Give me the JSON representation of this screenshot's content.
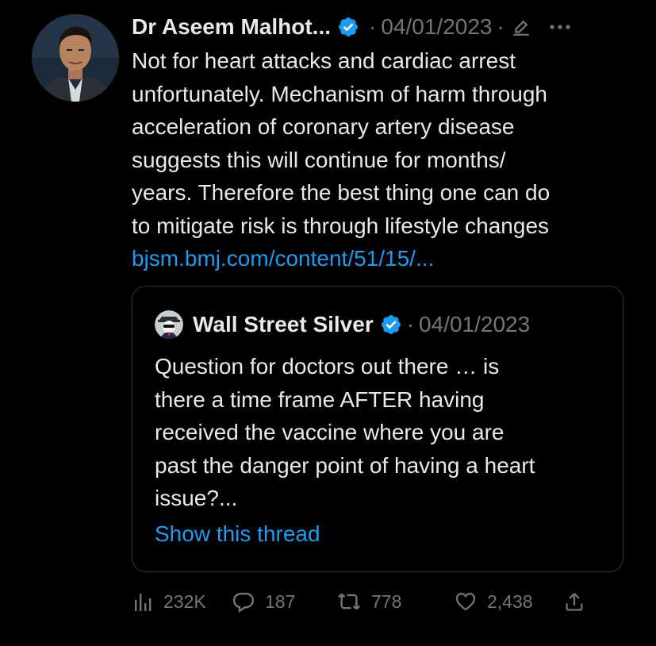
{
  "tweet": {
    "author_name": "Dr Aseem Malhot...",
    "date": "04/01/2023",
    "separator": "·",
    "more": "···",
    "text": "Not for heart attacks and cardiac arrest\nunfortunately. Mechanism of harm through\nacceleration of coronary artery disease\nsuggests this will continue for months/\nyears. Therefore the best thing one can do\nto mitigate risk is through lifestyle changes",
    "link": "bjsm.bmj.com/content/51/15/..."
  },
  "quote": {
    "author_name": "Wall Street Silver",
    "date": "04/01/2023",
    "separator": "·",
    "text": "Question for doctors out there … is\nthere a time frame AFTER having\nreceived the vaccine where you are\npast the danger point of having a heart\nissue?...",
    "show_thread": "Show this thread"
  },
  "actions": {
    "views": "232K",
    "replies": "187",
    "retweets": "778",
    "likes": "2,438"
  },
  "icons": {
    "verified": "verified-badge-icon",
    "edit": "edit-pencil-icon",
    "more": "more-icon",
    "views": "views-icon",
    "reply": "reply-icon",
    "retweet": "retweet-icon",
    "like": "heart-icon",
    "share": "share-icon"
  },
  "colors": {
    "background": "#000000",
    "text": "#e7e9ea",
    "muted": "#71767b",
    "accent": "#1d9bf0",
    "border": "#333639"
  }
}
